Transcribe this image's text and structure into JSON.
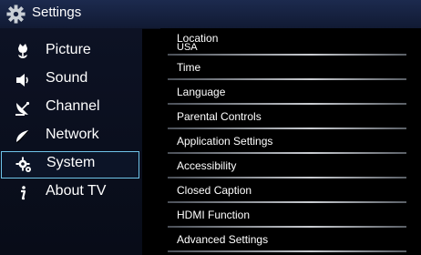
{
  "header": {
    "title": "Settings"
  },
  "nav": {
    "items": [
      {
        "label": "Picture",
        "icon": "tulip-icon"
      },
      {
        "label": "Sound",
        "icon": "speaker-icon"
      },
      {
        "label": "Channel",
        "icon": "satellite-dish-icon"
      },
      {
        "label": "Network",
        "icon": "network-icon"
      },
      {
        "label": "System",
        "icon": "gear-icon",
        "selected": true
      },
      {
        "label": "About TV",
        "icon": "info-icon"
      }
    ]
  },
  "settings": {
    "location": {
      "label": "Location",
      "value": "USA"
    },
    "items": [
      "Time",
      "Language",
      "Parental Controls",
      "Application Settings",
      "Accessibility",
      "Closed Caption",
      "HDMI Function",
      "Advanced Settings"
    ]
  },
  "colors": {
    "selection_border": "#6fc4e9",
    "titlebar": "#16203f"
  }
}
